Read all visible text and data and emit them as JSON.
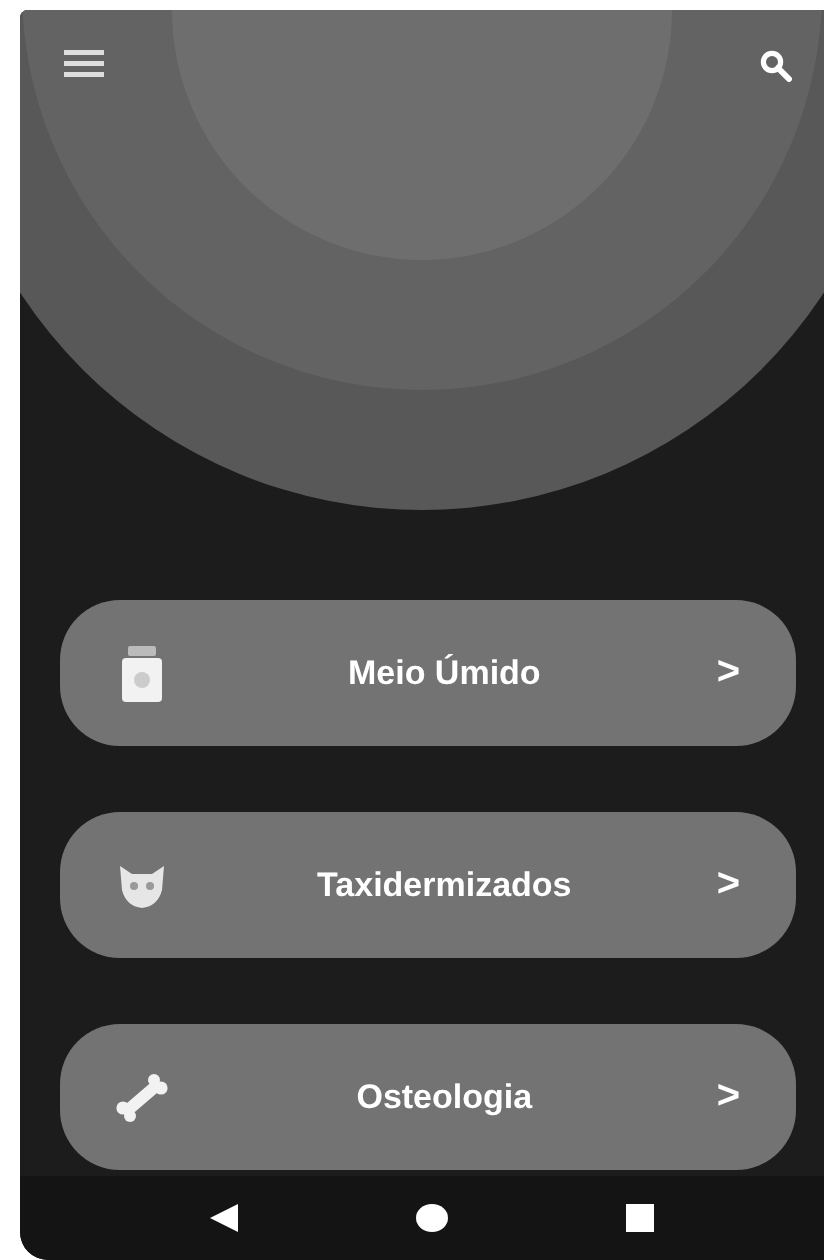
{
  "menu": [
    {
      "label": "Meio Úmido",
      "chevron": ">"
    },
    {
      "label": "Taxidermizados",
      "chevron": ">"
    },
    {
      "label": "Osteologia",
      "chevron": ">"
    }
  ]
}
